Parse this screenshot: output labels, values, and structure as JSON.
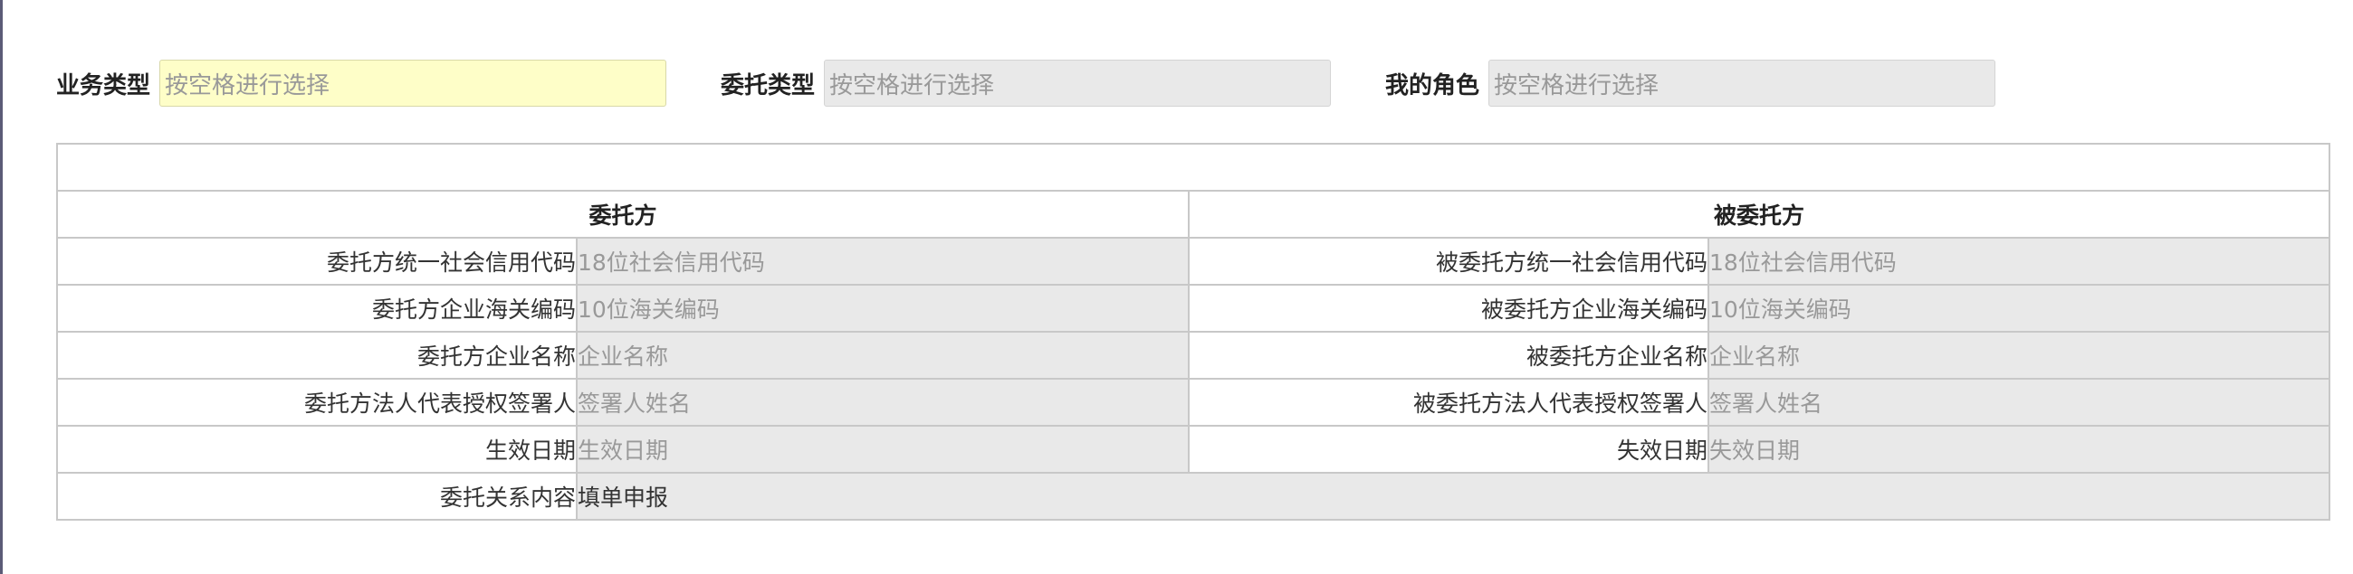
{
  "filters": {
    "business_type": {
      "label": "业务类型",
      "placeholder": "按空格进行选择"
    },
    "entrust_type": {
      "label": "委托类型",
      "placeholder": "按空格进行选择"
    },
    "my_role": {
      "label": "我的角色",
      "placeholder": "按空格进行选择"
    }
  },
  "table": {
    "principal_header": "委托方",
    "agent_header": "被委托方",
    "principal": {
      "credit_code_label": "委托方统一社会信用代码",
      "credit_code_placeholder": "18位社会信用代码",
      "customs_code_label": "委托方企业海关编码",
      "customs_code_placeholder": "10位海关编码",
      "company_name_label": "委托方企业名称",
      "company_name_placeholder": "企业名称",
      "signatory_label": "委托方法人代表授权签署人",
      "signatory_placeholder": "签署人姓名",
      "effective_date_label": "生效日期",
      "effective_date_placeholder": "生效日期"
    },
    "agent": {
      "credit_code_label": "被委托方统一社会信用代码",
      "credit_code_placeholder": "18位社会信用代码",
      "customs_code_label": "被委托方企业海关编码",
      "customs_code_placeholder": "10位海关编码",
      "company_name_label": "被委托方企业名称",
      "company_name_placeholder": "企业名称",
      "signatory_label": "被委托方法人代表授权签署人",
      "signatory_placeholder": "签署人姓名",
      "expiry_date_label": "失效日期",
      "expiry_date_placeholder": "失效日期"
    },
    "content_label": "委托关系内容",
    "content_value": "填单申报"
  }
}
